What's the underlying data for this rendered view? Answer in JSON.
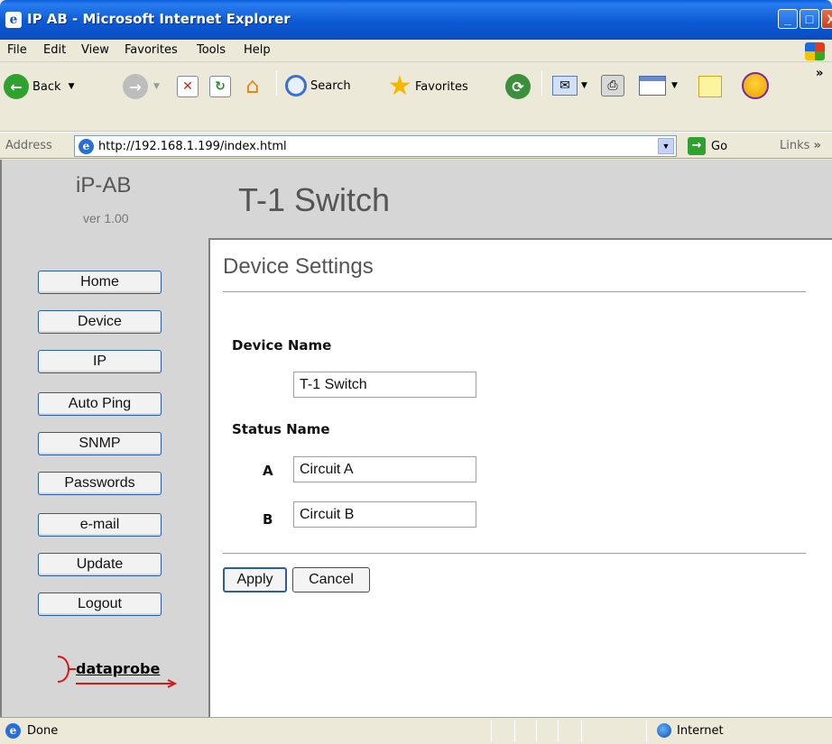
{
  "window": {
    "title": "IP AB - Microsoft Internet Explorer",
    "min_glyph": "_",
    "max_glyph": "□",
    "close_glyph": "X"
  },
  "menu": [
    "File",
    "Edit",
    "View",
    "Favorites",
    "Tools",
    "Help"
  ],
  "toolbar": {
    "back_label": "Back",
    "search_label": "Search",
    "favorites_label": "Favorites",
    "more_glyph": "»"
  },
  "address": {
    "label": "Address",
    "url": "http://192.168.1.199/index.html",
    "go_label": "Go",
    "links_label": "Links"
  },
  "sidebar": {
    "brand": "iP-AB",
    "version": "ver 1.00",
    "items": [
      {
        "label": "Home"
      },
      {
        "label": "Device"
      },
      {
        "label": "IP"
      },
      {
        "label": "Auto Ping"
      },
      {
        "label": "SNMP"
      },
      {
        "label": "Passwords"
      },
      {
        "label": "e-mail"
      },
      {
        "label": "Update"
      },
      {
        "label": "Logout"
      }
    ],
    "logo_text": "dataprobe"
  },
  "header": {
    "title": "T-1 Switch"
  },
  "content": {
    "section_title": "Device Settings",
    "device_name_label": "Device Name",
    "device_name_value": "T-1 Switch",
    "status_name_label": "Status Name",
    "status_a_label": "A",
    "status_a_value": "Circuit A",
    "status_b_label": "B",
    "status_b_value": "Circuit B",
    "apply_label": "Apply",
    "cancel_label": "Cancel"
  },
  "statusbar": {
    "status_text": "Done",
    "zone_text": "Internet"
  }
}
